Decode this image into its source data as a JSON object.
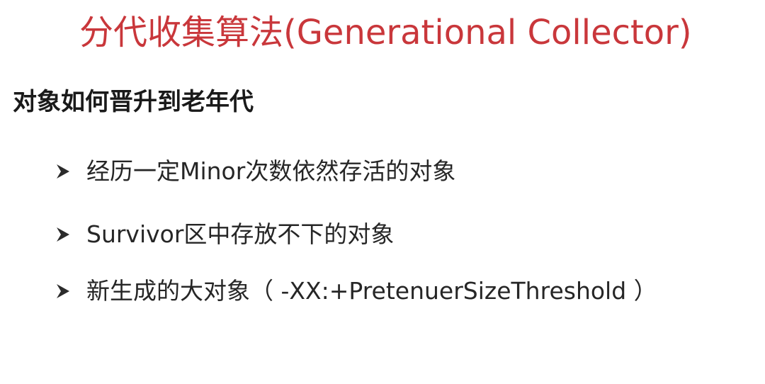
{
  "slide": {
    "title": "分代收集算法(Generational Collector)",
    "subheading": "对象如何晋升到老年代",
    "bullets": [
      {
        "text": "经历一定Minor次数依然存活的对象",
        "icon": "arrowhead-bullet-icon"
      },
      {
        "text": "Survivor区中存放不下的对象",
        "icon": "arrowhead-bullet-icon"
      },
      {
        "text": "新生成的大对象（ -XX:+PretenuerSizeThreshold ）",
        "icon": "arrowhead-bullet-icon"
      }
    ]
  },
  "colors": {
    "title": "#c9373b",
    "text": "#262626",
    "background": "#ffffff"
  }
}
